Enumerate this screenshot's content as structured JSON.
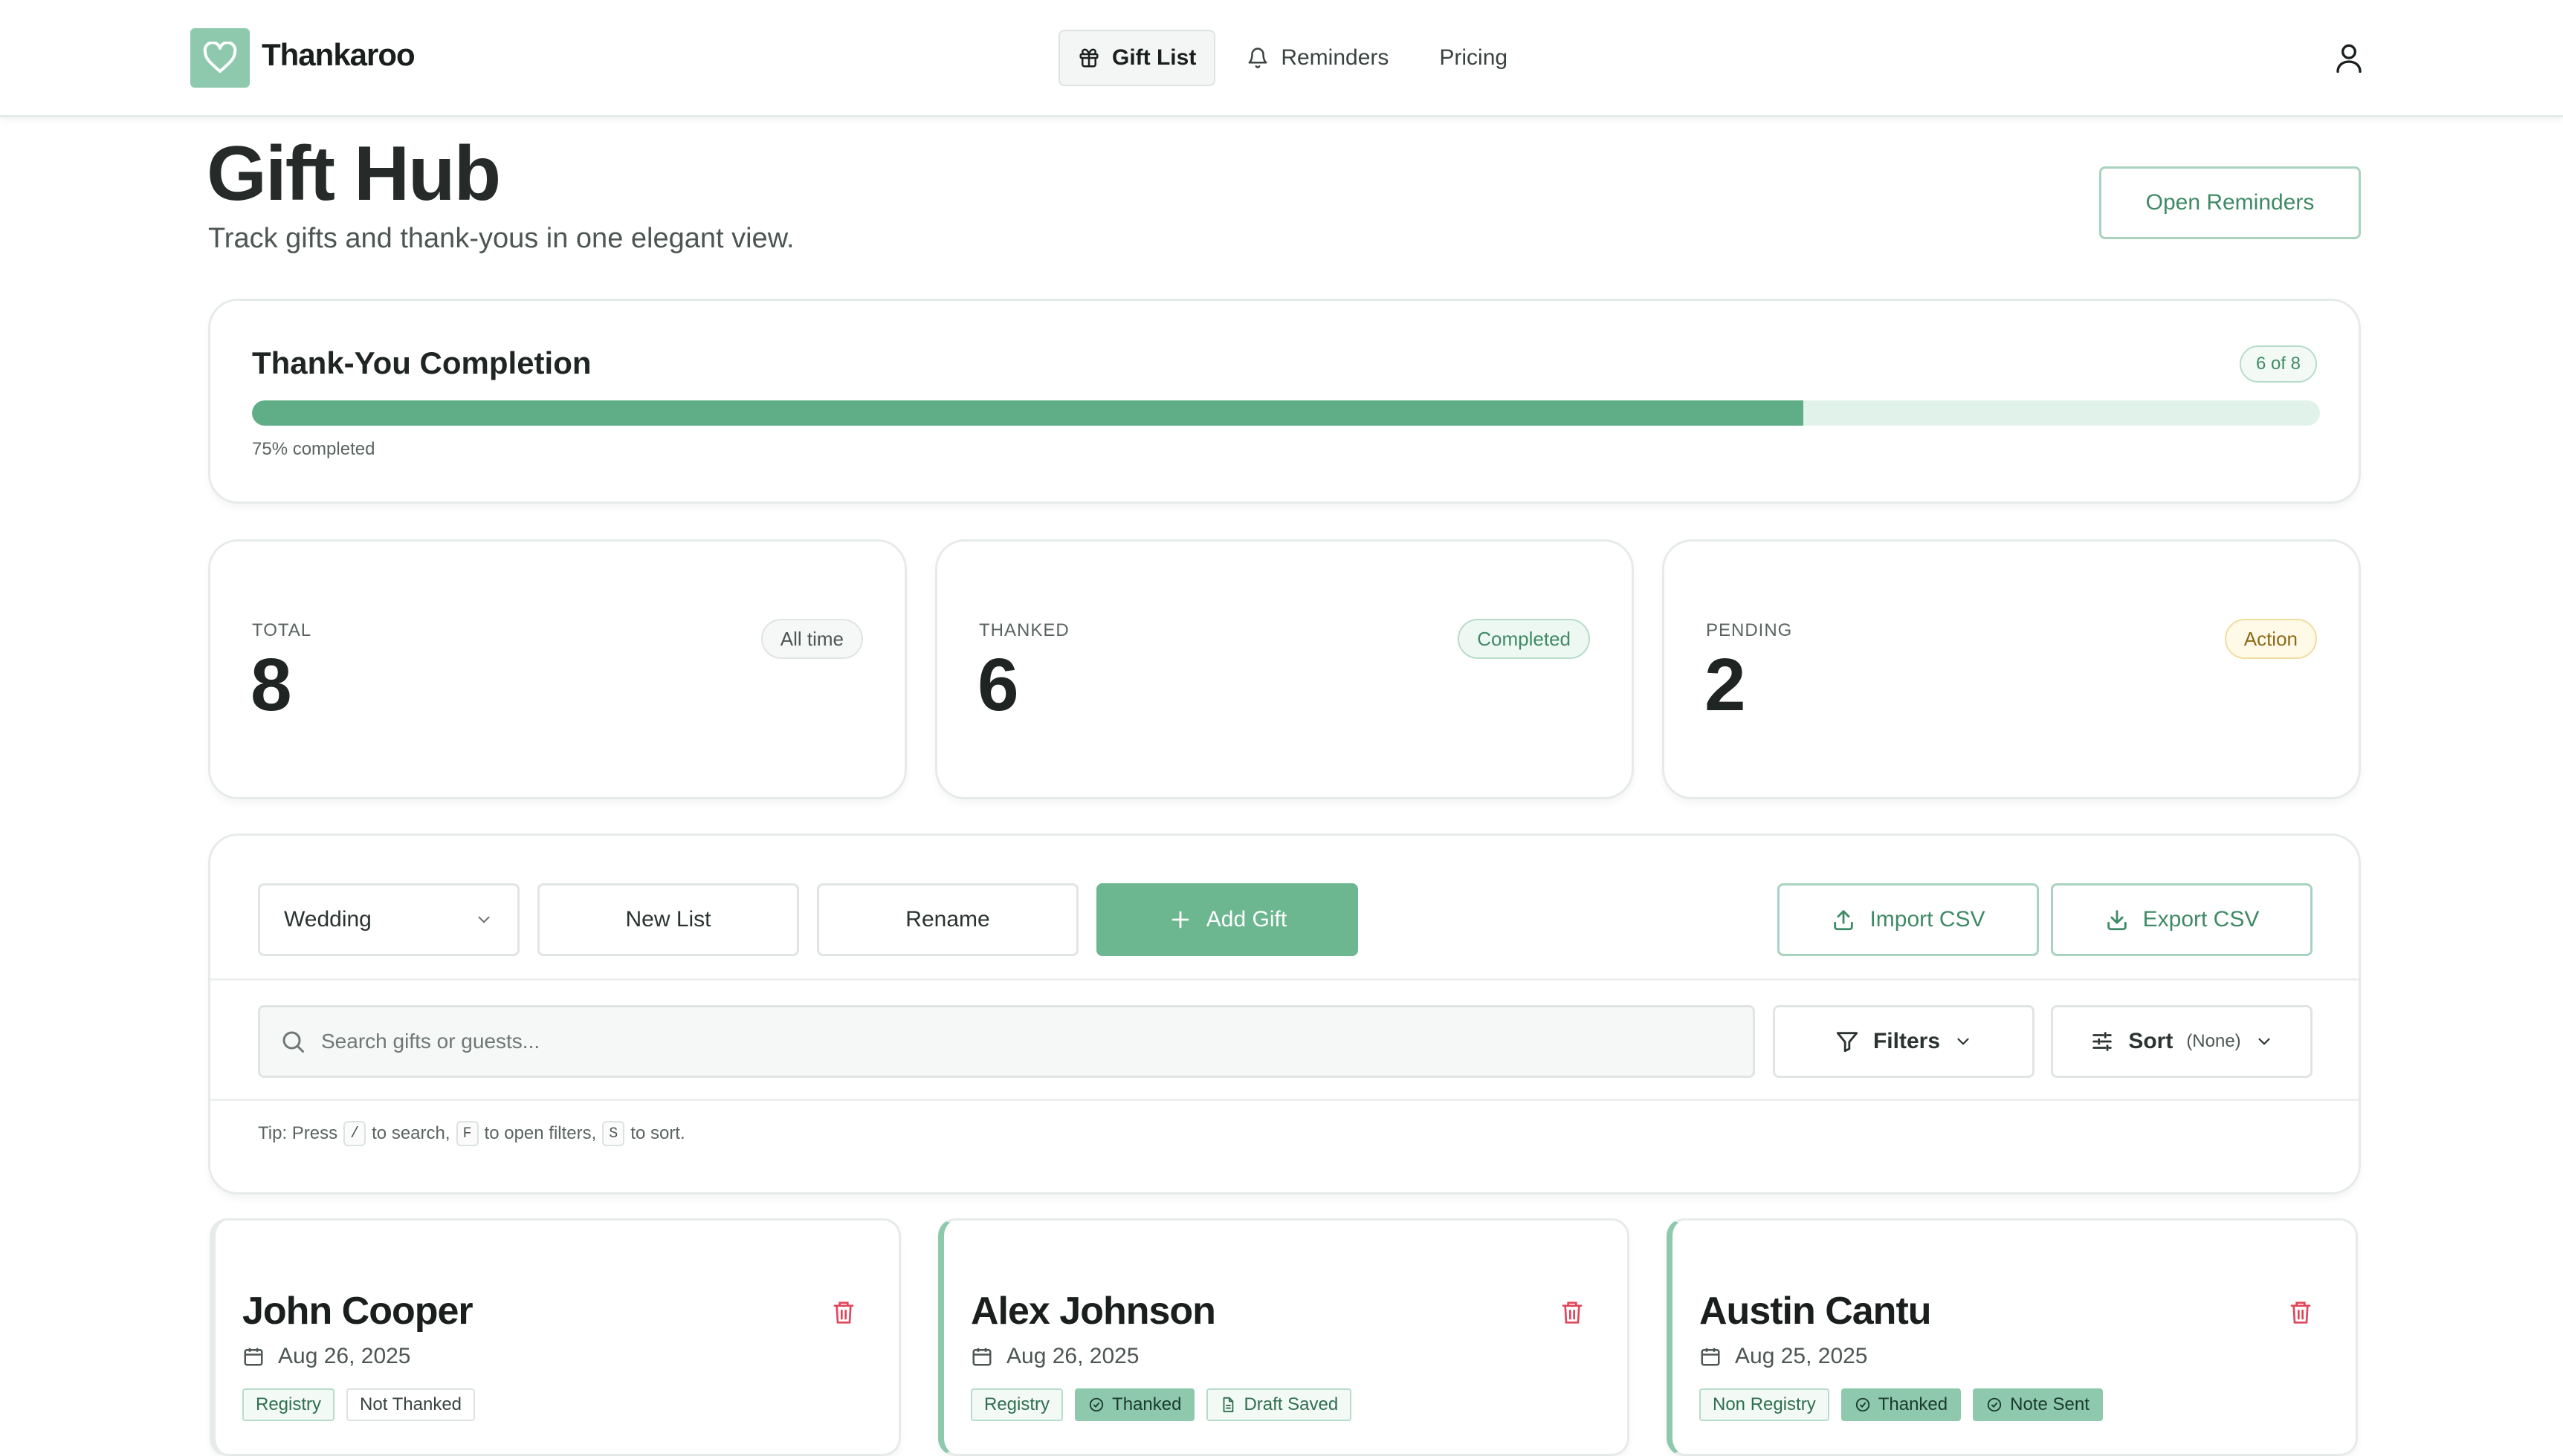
{
  "app": {
    "name": "Thankaroo"
  },
  "nav": [
    {
      "label": "Gift List",
      "icon": "gift-icon",
      "active": true
    },
    {
      "label": "Reminders",
      "icon": "bell-icon",
      "active": false
    },
    {
      "label": "Pricing",
      "icon": "",
      "active": false
    }
  ],
  "page": {
    "title": "Gift Hub",
    "subtitle": "Track gifts and thank-yous in one elegant view.",
    "open_reminders_label": "Open Reminders"
  },
  "progress": {
    "title": "Thank-You Completion",
    "badge": "6 of 8",
    "percent": 75,
    "label": "75% completed"
  },
  "stats": [
    {
      "label": "TOTAL",
      "value": "8",
      "pill": "All time"
    },
    {
      "label": "THANKED",
      "value": "6",
      "pill": "Completed"
    },
    {
      "label": "PENDING",
      "value": "2",
      "pill": "Action"
    }
  ],
  "toolbar": {
    "list_select": "Wedding",
    "new_list": "New List",
    "rename": "Rename",
    "add_gift": "Add Gift",
    "import_csv": "Import CSV",
    "export_csv": "Export CSV",
    "search_placeholder": "Search gifts or guests...",
    "filters": "Filters",
    "sort": "Sort",
    "sort_value": "(None)",
    "tip": {
      "prefix": "Tip: Press",
      "key1": "/",
      "mid1": "to search,",
      "key2": "F",
      "mid2": "to open filters,",
      "key3": "S",
      "suffix": "to sort."
    }
  },
  "gifts": [
    {
      "name": "John Cooper",
      "date": "Aug 26, 2025",
      "tags": [
        "Registry",
        "Not Thanked"
      ]
    },
    {
      "name": "Alex Johnson",
      "date": "Aug 26, 2025",
      "tags": [
        "Registry",
        "Thanked",
        "Draft Saved"
      ]
    },
    {
      "name": "Austin Cantu",
      "date": "Aug 25, 2025",
      "tags": [
        "Non Registry",
        "Thanked",
        "Note Sent"
      ]
    }
  ],
  "colors": {
    "accent": "#6cb690",
    "accent_dark": "#3f8a66",
    "logo_bg": "#8ec9ae",
    "danger": "#e0455a"
  }
}
